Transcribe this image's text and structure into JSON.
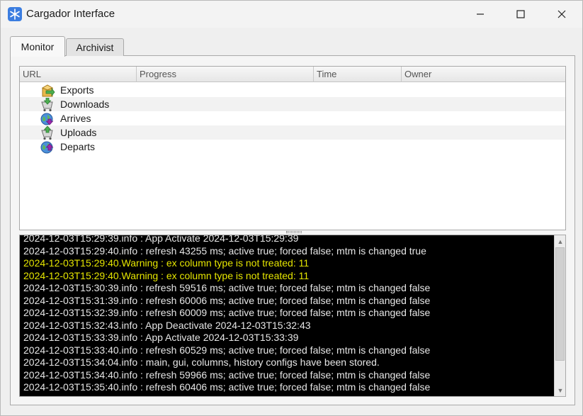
{
  "window": {
    "title": "Cargador Interface",
    "icon": "snowflake-app-icon",
    "accent": "#3b7de0"
  },
  "tabs": [
    {
      "label": "Monitor",
      "active": true
    },
    {
      "label": "Archivist",
      "active": false
    }
  ],
  "table": {
    "columns": [
      "URL",
      "Progress",
      "Time",
      "Owner"
    ],
    "rows": [
      {
        "label": "Exports",
        "icon": "export-box-icon"
      },
      {
        "label": "Downloads",
        "icon": "download-cart-icon"
      },
      {
        "label": "Arrives",
        "icon": "arrive-globe-icon"
      },
      {
        "label": "Uploads",
        "icon": "upload-cart-icon"
      },
      {
        "label": "Departs",
        "icon": "depart-globe-icon"
      }
    ]
  },
  "log": {
    "lines": [
      {
        "text": "2024-12-03T15:29:39.info : App Activate 2024-12-03T15:29:39",
        "level": "info"
      },
      {
        "text": "2024-12-03T15:29:40.info : refresh 43255 ms; active true; forced false; mtm is changed true",
        "level": "info"
      },
      {
        "text": "2024-12-03T15:29:40.Warning : ex column type is not treated: 11",
        "level": "warning"
      },
      {
        "text": "2024-12-03T15:29:40.Warning : ex column type is not treated: 11",
        "level": "warning"
      },
      {
        "text": "2024-12-03T15:30:39.info : refresh 59516 ms; active true; forced false; mtm is changed false",
        "level": "info"
      },
      {
        "text": "2024-12-03T15:31:39.info : refresh 60006 ms; active true; forced false; mtm is changed false",
        "level": "info"
      },
      {
        "text": "2024-12-03T15:32:39.info : refresh 60009 ms; active true; forced false; mtm is changed false",
        "level": "info"
      },
      {
        "text": "2024-12-03T15:32:43.info : App Deactivate 2024-12-03T15:32:43",
        "level": "info"
      },
      {
        "text": "2024-12-03T15:33:39.info : App Activate 2024-12-03T15:33:39",
        "level": "info"
      },
      {
        "text": "2024-12-03T15:33:40.info : refresh 60529 ms; active true; forced false; mtm is changed false",
        "level": "info"
      },
      {
        "text": "2024-12-03T15:34:04.info : main, gui, columns, history configs have been stored.",
        "level": "info"
      },
      {
        "text": "2024-12-03T15:34:40.info : refresh 59966 ms; active true; forced false; mtm is changed false",
        "level": "info"
      },
      {
        "text": "2024-12-03T15:35:40.info : refresh 60406 ms; active true; forced false; mtm is changed false",
        "level": "info"
      }
    ],
    "text_color": "#e6e6e6",
    "warning_color": "#e6e600",
    "background": "#000000"
  }
}
